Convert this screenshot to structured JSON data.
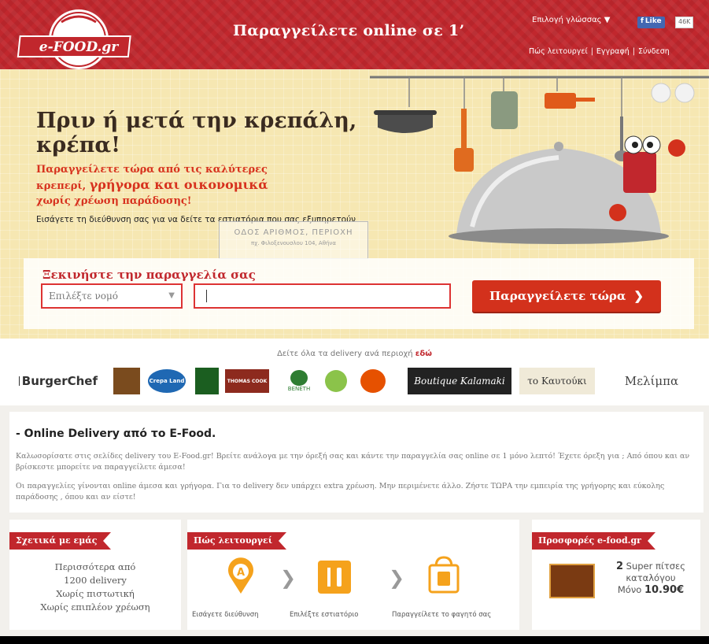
{
  "header": {
    "logo_text": "e-FOOD.gr",
    "tagline": "Παραγγείλετε online σε 1’",
    "language_label": "Επιλογή γλώσσας ▼",
    "fb_like_label": "Like",
    "fb_like_count": "46K",
    "links": [
      "Πώς λειτουργεί",
      "Εγγραφή",
      "Σύνδεση"
    ],
    "link_separator": "|"
  },
  "hero": {
    "title_line1": "Πριν ή μετά την κρεπάλη,",
    "title_line2": "κρέπα!",
    "sub_line1": "Παραγγείλετε τώρα από τις καλύτερες",
    "sub_line2_a": "κρεπερί, ",
    "sub_line2_b": "γρήγορα και οικονομικά",
    "sub_line3": "χωρίς χρέωση παράδοσης!",
    "note": "Εισάγετε τη διεύθυνση σας για να δείτε τα εστιατόρια που σας εξυπηρετούν",
    "tip_line1": "ΟΔΟΣ  ΑΡΙΘΜΟΣ, ΠΕΡΙΟΧΗ",
    "tip_line2": "πχ. Φιλοξενουσλου 104, Αθήνα"
  },
  "order": {
    "label": "Ξεκινήστε την παραγγελία σας",
    "county_placeholder": "Επιλέξτε νομό",
    "address_value": "",
    "button_label": "Παραγγείλετε τώρα",
    "button_chevron": "❯"
  },
  "brands": {
    "line_text": "Δείτε όλα τα delivery ανά περιοχή ",
    "line_link": "εδώ",
    "items": [
      "BurgerChef",
      "Crepa Land",
      "THOMAS COOK",
      "BENETH",
      "Boutique Kalamaki",
      "το Καυτούκι",
      "Μελίμπα"
    ]
  },
  "intro": {
    "title": "- Online Delivery από το E-Food.",
    "p1": "Καλωσορίσατε στις σελίδες delivery του E-Food.gr! Βρείτε ανάλογα με την όρεξή σας και κάντε την παραγγελία σας online σε 1 μόνο λεπτό! Έχετε όρεξη για ; Από όπου και αν βρίσκεστε μπορείτε να παραγγείλετε άμεσα!",
    "p2": "Οι παραγγελίες γίνονται online άμεσα και γρήγορα. Για το delivery δεν υπάρχει extra χρέωση. Μην περιμένετε άλλο. Ζήστε ΤΩΡΑ την εμπειρία της γρήγορης και εύκολης παράδοσης , όπου και αν είστε!"
  },
  "about": {
    "title": "Σχετικά με εμάς",
    "lines": [
      "Περισσότερα από",
      "1200 delivery",
      "Χωρίς πιστωτική",
      "Χωρίς επιπλέον χρέωση"
    ]
  },
  "how": {
    "title": "Πώς λειτουργεί",
    "steps": [
      "Εισάγετε διεύθυνση",
      "Επιλέξτε εστιατόριο",
      "Παραγγείλετε το φαγητό σας"
    ],
    "chevron": "❯"
  },
  "offers": {
    "title": "Προσφορές e-food.gr",
    "line1_bold": "2",
    "line1_rest": " Super πίτσες",
    "line2": "καταλόγου",
    "line3_a": "Μόνο ",
    "line3_b": "10.90€"
  },
  "colors": {
    "brand_red": "#c1272d",
    "hero_bg": "#f6e7b2",
    "cta_red": "#d3311c"
  }
}
